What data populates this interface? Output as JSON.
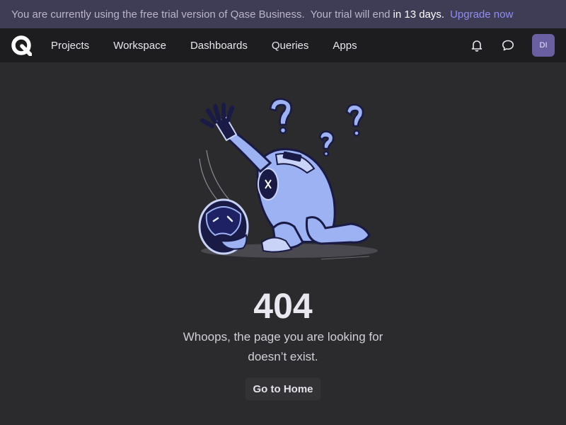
{
  "banner": {
    "text_part1": "You are currently using the free trial version of Qase Business.",
    "text_part2": "Your trial will end",
    "days": "in 13 days.",
    "upgrade_label": "Upgrade now"
  },
  "nav": {
    "items": [
      {
        "label": "Projects"
      },
      {
        "label": "Workspace"
      },
      {
        "label": "Dashboards"
      },
      {
        "label": "Queries"
      },
      {
        "label": "Apps"
      }
    ],
    "avatar_initials": "DI",
    "icons": [
      "bell-icon",
      "chat-icon"
    ]
  },
  "error": {
    "code": "404",
    "message": "Whoops, the page you are looking for doesn’t exist.",
    "button_label": "Go to Home"
  },
  "colors": {
    "background": "#2b2a2c",
    "banner": "#3f3c55",
    "nav": "#1d1c1e",
    "accent": "#8f8ef0",
    "robot_body": "#9cb2f2",
    "robot_dark": "#191a45"
  }
}
